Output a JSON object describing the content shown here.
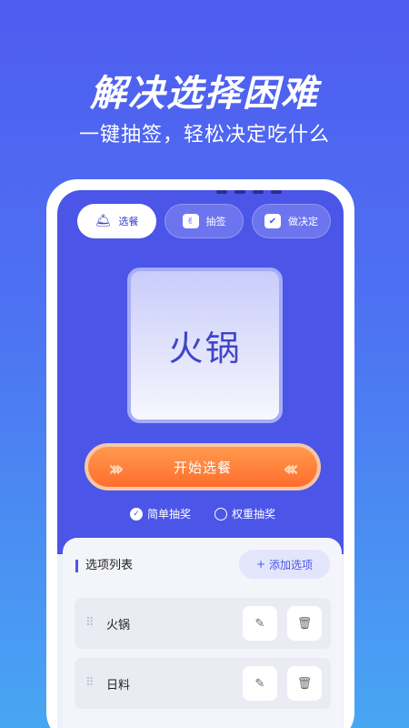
{
  "hero": {
    "title": "解决选择困难",
    "subtitle": "一键抽签，轻松决定吃什么"
  },
  "tabs": [
    {
      "label": "选餐",
      "icon": "cloche-icon",
      "active": true
    },
    {
      "label": "抽签",
      "icon": "lottery-icon",
      "active": false
    },
    {
      "label": "做决定",
      "icon": "checklist-icon",
      "active": false
    }
  ],
  "result": {
    "text": "火锅"
  },
  "start_button": {
    "label": "开始选餐"
  },
  "modes": [
    {
      "label": "简单抽奖",
      "selected": true
    },
    {
      "label": "权重抽奖",
      "selected": false
    }
  ],
  "options_list": {
    "title": "选项列表",
    "add_label": "添加选项",
    "items": [
      {
        "label": "火锅"
      },
      {
        "label": "日料"
      }
    ]
  },
  "colors": {
    "primary": "#4b55e8",
    "accent": "#ff7a35",
    "background": "#4f5cf0"
  }
}
